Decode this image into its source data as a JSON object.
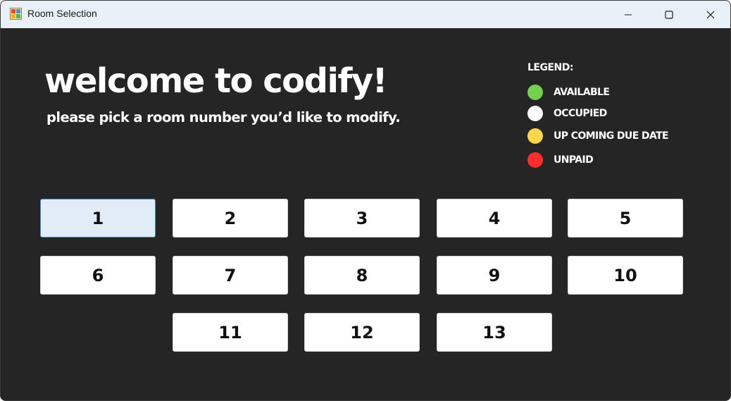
{
  "window": {
    "title": "Room Selection",
    "app_icon": "winforms-app-icon",
    "controls": [
      "minimize-icon",
      "maximize-icon",
      "close-icon"
    ]
  },
  "main": {
    "heading": "welcome to codify!",
    "subheading": "please pick a room number you’d like to modify."
  },
  "legend": {
    "title": "LEGEND:",
    "items": [
      {
        "label": "AVAILABLE",
        "color": "#74d14c"
      },
      {
        "label": "OCCUPIED",
        "color": "#ffffff"
      },
      {
        "label": "UP COMING DUE DATE",
        "color": "#ffd54a"
      },
      {
        "label": "UNPAID",
        "color": "#ff2d2d"
      }
    ]
  },
  "rooms": [
    {
      "label": "1",
      "focused": true
    },
    {
      "label": "2"
    },
    {
      "label": "3"
    },
    {
      "label": "4"
    },
    {
      "label": "5"
    },
    {
      "label": "6"
    },
    {
      "label": "7"
    },
    {
      "label": "8"
    },
    {
      "label": "9"
    },
    {
      "label": "10"
    },
    {
      "label": "11"
    },
    {
      "label": "12"
    },
    {
      "label": "13"
    }
  ],
  "colors": {
    "background": "#252525",
    "titlebar": "#e9f0f7",
    "button": "#ffffff",
    "focused_button": "#e1ecf7",
    "focus_border": "#3c8fd8"
  }
}
